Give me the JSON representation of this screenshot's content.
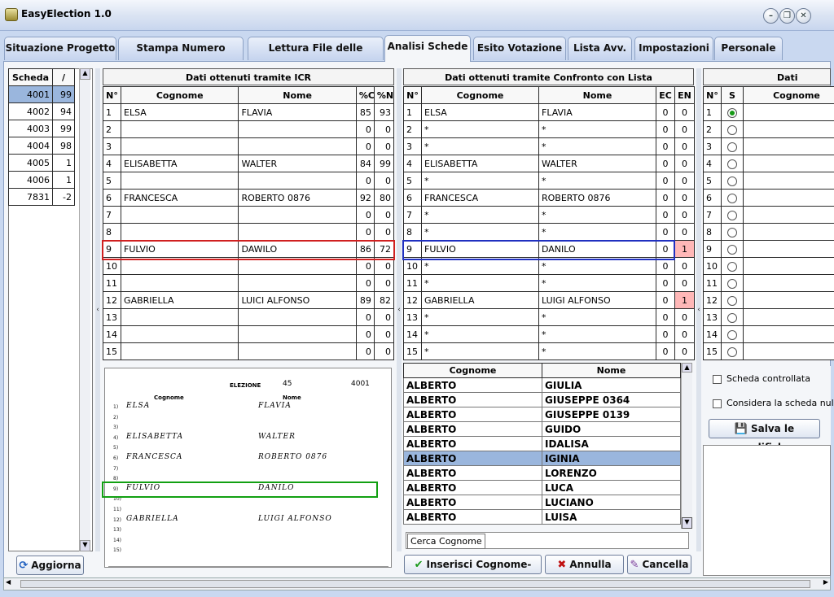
{
  "window": {
    "title": "EasyElection 1.0"
  },
  "tabs": [
    {
      "label": "Situazione Progetto"
    },
    {
      "label": "Stampa Numero Schede"
    },
    {
      "label": "Lettura File delle Schede"
    },
    {
      "label": "Analisi Schede",
      "active": true
    },
    {
      "label": "Esito Votazione"
    },
    {
      "label": "Lista Avv."
    },
    {
      "label": "Impostazioni"
    },
    {
      "label": "Personale"
    }
  ],
  "schede_list": {
    "headers": [
      "Scheda",
      "/"
    ],
    "rows": [
      [
        "4001",
        "99"
      ],
      [
        "4002",
        "94"
      ],
      [
        "4003",
        "99"
      ],
      [
        "4004",
        "98"
      ],
      [
        "4005",
        "1"
      ],
      [
        "4006",
        "1"
      ],
      [
        "7831",
        "-2"
      ]
    ],
    "selected_index": 0,
    "refresh_label": "Aggiorna"
  },
  "icr": {
    "title": "Dati ottenuti tramite ICR",
    "headers": [
      "N°",
      "Cognome",
      "Nome",
      "%C",
      "%N"
    ],
    "rows": [
      [
        "1",
        "ELSA",
        "FLAVIA",
        "85",
        "93"
      ],
      [
        "2",
        "",
        "",
        "0",
        "0"
      ],
      [
        "3",
        "",
        "",
        "0",
        "0"
      ],
      [
        "4",
        "ELISABETTA",
        "WALTER",
        "84",
        "99"
      ],
      [
        "5",
        "",
        "",
        "0",
        "0"
      ],
      [
        "6",
        "FRANCESCA",
        "ROBERTO 0876",
        "92",
        "80"
      ],
      [
        "7",
        "",
        "",
        "0",
        "0"
      ],
      [
        "8",
        "",
        "",
        "0",
        "0"
      ],
      [
        "9",
        "FULVIO",
        "DAWILO",
        "86",
        "72"
      ],
      [
        "10",
        "",
        "",
        "0",
        "0"
      ],
      [
        "11",
        "",
        "",
        "0",
        "0"
      ],
      [
        "12",
        "GABRIELLA",
        "LUICI ALFONSO",
        "89",
        "82"
      ],
      [
        "13",
        "",
        "",
        "0",
        "0"
      ],
      [
        "14",
        "",
        "",
        "0",
        "0"
      ],
      [
        "15",
        "",
        "",
        "0",
        "0"
      ]
    ],
    "highlighted_row": 9
  },
  "scan": {
    "header_word": "ELEZIONE",
    "header_num": "45",
    "header_id": "4001",
    "col_cognome": "Cognome",
    "col_nome": "Nome",
    "lines": [
      {
        "n": "1)",
        "c": "ELSA",
        "nm": "FLAVIA"
      },
      {
        "n": "2)",
        "c": "",
        "nm": ""
      },
      {
        "n": "3)",
        "c": "",
        "nm": ""
      },
      {
        "n": "4)",
        "c": "ELISABETTA",
        "nm": "WALTER"
      },
      {
        "n": "5)",
        "c": "",
        "nm": ""
      },
      {
        "n": "6)",
        "c": "FRANCESCA",
        "nm": "ROBERTO 0876"
      },
      {
        "n": "7)",
        "c": "",
        "nm": ""
      },
      {
        "n": "8)",
        "c": "",
        "nm": ""
      },
      {
        "n": "9)",
        "c": "FULVIO",
        "nm": "DANILO"
      },
      {
        "n": "10)",
        "c": "",
        "nm": ""
      },
      {
        "n": "11)",
        "c": "",
        "nm": ""
      },
      {
        "n": "12)",
        "c": "GABRIELLA",
        "nm": "LUIGI ALFONSO"
      },
      {
        "n": "13)",
        "c": "",
        "nm": ""
      },
      {
        "n": "14)",
        "c": "",
        "nm": ""
      },
      {
        "n": "15)",
        "c": "",
        "nm": ""
      }
    ]
  },
  "confronto": {
    "title": "Dati ottenuti tramite Confronto con Lista",
    "headers": [
      "N°",
      "Cognome",
      "Nome",
      "EC",
      "EN"
    ],
    "rows": [
      [
        "1",
        "ELSA",
        "FLAVIA",
        "0",
        "0"
      ],
      [
        "2",
        "*",
        "*",
        "0",
        "0"
      ],
      [
        "3",
        "*",
        "*",
        "0",
        "0"
      ],
      [
        "4",
        "ELISABETTA",
        "WALTER",
        "0",
        "0"
      ],
      [
        "5",
        "*",
        "*",
        "0",
        "0"
      ],
      [
        "6",
        "FRANCESCA",
        "ROBERTO 0876",
        "0",
        "0"
      ],
      [
        "7",
        "*",
        "*",
        "0",
        "0"
      ],
      [
        "8",
        "*",
        "*",
        "0",
        "0"
      ],
      [
        "9",
        "FULVIO",
        "DANILO",
        "0",
        "1"
      ],
      [
        "10",
        "*",
        "*",
        "0",
        "0"
      ],
      [
        "11",
        "*",
        "*",
        "0",
        "0"
      ],
      [
        "12",
        "GABRIELLA",
        "LUIGI ALFONSO",
        "0",
        "1"
      ],
      [
        "13",
        "*",
        "*",
        "0",
        "0"
      ],
      [
        "14",
        "*",
        "*",
        "0",
        "0"
      ],
      [
        "15",
        "*",
        "*",
        "0",
        "0"
      ]
    ],
    "highlighted_row": 9,
    "en_flag_color": "#ffb7b7"
  },
  "lista": {
    "headers": [
      "Cognome",
      "Nome"
    ],
    "rows": [
      [
        "ALBERTO",
        "GIULIA"
      ],
      [
        "ALBERTO",
        "GIUSEPPE 0364"
      ],
      [
        "ALBERTO",
        "GIUSEPPE 0139"
      ],
      [
        "ALBERTO",
        "GUIDO"
      ],
      [
        "ALBERTO",
        "IDALISA"
      ],
      [
        "ALBERTO",
        "IGINIA"
      ],
      [
        "ALBERTO",
        "LORENZO"
      ],
      [
        "ALBERTO",
        "LUCA"
      ],
      [
        "ALBERTO",
        "LUCIANO"
      ],
      [
        "ALBERTO",
        "LUISA"
      ]
    ],
    "selected_index": 5,
    "search_placeholder": "Cerca Cognome",
    "btn_insert": "Inserisci Cognome-Nome",
    "btn_annulla": "Annulla riga",
    "btn_cancella": "Cancella"
  },
  "modifiche": {
    "title": "Dati modifi",
    "headers": [
      "N°",
      "S",
      "Cognome"
    ],
    "rows": [
      "1",
      "2",
      "3",
      "4",
      "5",
      "6",
      "7",
      "8",
      "9",
      "10",
      "11",
      "12",
      "13",
      "14",
      "15"
    ],
    "selected_radio": 0,
    "chk_controllata": "Scheda controllata",
    "chk_nulla": "Considera la scheda nulla",
    "btn_salva": "Salva le modifiche"
  },
  "colors": {
    "selection": "#9ab6dd",
    "icr_highlight": "#d02020",
    "list_highlight": "#2030c0",
    "scan_highlight": "#12a012"
  }
}
